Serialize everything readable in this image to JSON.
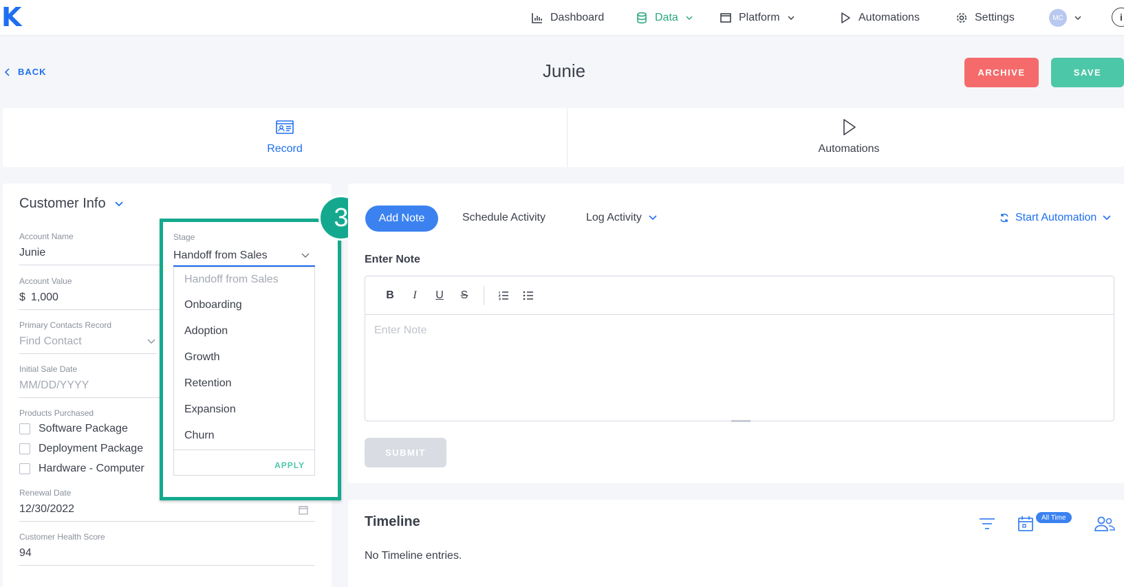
{
  "app": {
    "logo": "K"
  },
  "nav": {
    "dashboard": "Dashboard",
    "data": "Data",
    "platform": "Platform",
    "automations": "Automations",
    "settings": "Settings",
    "avatar_initials": "MC",
    "info": "i"
  },
  "header": {
    "back": "BACK",
    "title": "Junie",
    "archive": "ARCHIVE",
    "save": "SAVE"
  },
  "tabs": [
    {
      "label": "Record"
    },
    {
      "label": "Automations"
    }
  ],
  "customer_info": {
    "title": "Customer Info",
    "account_name": {
      "label": "Account Name",
      "value": "Junie"
    },
    "account_value": {
      "label": "Account Value",
      "currency": "$",
      "value": "1,000"
    },
    "primary_contacts": {
      "label": "Primary Contacts Record",
      "placeholder": "Find Contact"
    },
    "initial_sale_date": {
      "label": "Initial Sale Date",
      "placeholder": "MM/DD/YYYY"
    },
    "products": {
      "label": "Products Purchased",
      "items": [
        "Software Package",
        "Deployment Package",
        "Hardware - Computer"
      ]
    },
    "renewal_date": {
      "label": "Renewal Date",
      "value": "12/30/2022"
    },
    "health_score": {
      "label": "Customer Health Score",
      "value": "94"
    }
  },
  "stage": {
    "label": "Stage",
    "value": "Handoff from Sales",
    "options": [
      "Handoff from Sales",
      "Onboarding",
      "Adoption",
      "Growth",
      "Retention",
      "Expansion",
      "Churn"
    ],
    "apply": "APPLY",
    "step_badge": "3"
  },
  "activity": {
    "add_note": "Add Note",
    "schedule": "Schedule Activity",
    "log": "Log Activity",
    "start_automation": "Start Automation",
    "enter_note_label": "Enter Note",
    "editor_placeholder": "Enter Note",
    "submit": "SUBMIT"
  },
  "toolbar": {
    "bold": "B",
    "italic": "I",
    "underline": "U",
    "strike": "S"
  },
  "timeline": {
    "title": "Timeline",
    "empty": "No Timeline entries.",
    "filter_badge": "All Time"
  },
  "colors": {
    "primary": "#1e6ff0",
    "archive": "#f56b6b",
    "save": "#4cc7a8",
    "highlight": "#14a98e",
    "data_nav": "#2aa87a"
  }
}
